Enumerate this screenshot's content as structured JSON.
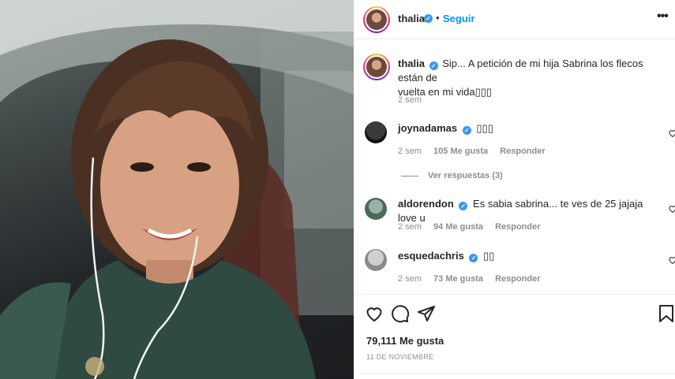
{
  "post": {
    "username": "thalia",
    "dot": "•",
    "follow_label": "Seguir",
    "more_label": "•••"
  },
  "caption": {
    "username": "thalia",
    "line1": "Sip... A petición de mi hija Sabrina los flecos están de",
    "line2": "vuelta en mi vida",
    "emoji": "▯▯▯",
    "time": "2 sem"
  },
  "comments": [
    {
      "username": "joynadamas",
      "verified": true,
      "text": "▯▯▯",
      "time": "2 sem",
      "likes": "105 Me gusta",
      "reply": "Responder"
    },
    {
      "username": "aldorendon",
      "verified": true,
      "text": "Es sabia sabrina... te ves de 25 jajaja love u",
      "time": "2 sem",
      "likes": "94 Me gusta",
      "reply": "Responder"
    },
    {
      "username": "esquedachris",
      "verified": true,
      "text": "▯▯",
      "time": "2 sem",
      "likes": "73 Me gusta",
      "reply": "Responder"
    }
  ],
  "view_replies": "Ver respuestas (3)",
  "footer": {
    "likes": "79,111 Me gusta",
    "date": "11 DE NOVIEMBRE"
  },
  "icons": [
    "heart-icon",
    "comment-icon",
    "share-icon",
    "bookmark-icon",
    "verified-icon",
    "more-options-icon"
  ],
  "colors": {
    "accent": "#0095f6",
    "verified": "#3897f0",
    "muted": "#8e8e8e"
  }
}
